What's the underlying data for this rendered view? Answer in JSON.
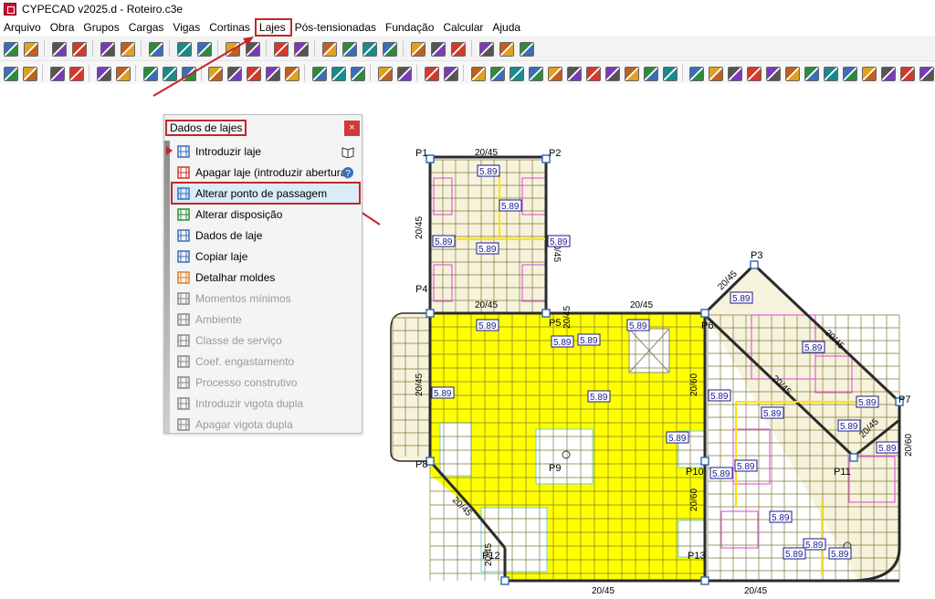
{
  "window": {
    "title": "CYPECAD v2025.d - Roteiro.c3e"
  },
  "menu": {
    "items": [
      "Arquivo",
      "Obra",
      "Grupos",
      "Cargas",
      "Vigas",
      "Cortinas",
      "Lajes",
      "Pós-tensionadas",
      "Fundação",
      "Calcular",
      "Ajuda"
    ],
    "highlighted": "Lajes"
  },
  "panel": {
    "title": "Dados de lajes",
    "close_label": "×",
    "items": [
      {
        "label": "Introduzir laje",
        "enabled": true,
        "icon": "introduzir-laje-icon"
      },
      {
        "label": "Apagar laje (introduzir abertura)",
        "enabled": true,
        "icon": "apagar-laje-icon"
      },
      {
        "label": "Alterar ponto de passagem",
        "enabled": true,
        "icon": "alterar-ponto-icon",
        "selected": true
      },
      {
        "label": "Alterar disposição",
        "enabled": true,
        "icon": "alterar-disposicao-icon"
      },
      {
        "label": "Dados de laje",
        "enabled": true,
        "icon": "dados-laje-icon"
      },
      {
        "label": "Copiar laje",
        "enabled": true,
        "icon": "copiar-laje-icon"
      },
      {
        "label": "Detalhar moldes",
        "enabled": true,
        "icon": "detalhar-moldes-icon"
      },
      {
        "label": "Momentos mínimos",
        "enabled": false,
        "icon": "momentos-icon"
      },
      {
        "label": "Ambiente",
        "enabled": false,
        "icon": "ambiente-icon"
      },
      {
        "label": "Classe de serviço",
        "enabled": false,
        "icon": "classe-icon"
      },
      {
        "label": "Coef. engastamento",
        "enabled": false,
        "icon": "coef-icon"
      },
      {
        "label": "Processo construtivo",
        "enabled": false,
        "icon": "processo-icon"
      },
      {
        "label": "Introduzir vigota dupla",
        "enabled": false,
        "icon": "introduzir-vigota-icon"
      },
      {
        "label": "Apagar vigota dupla",
        "enabled": false,
        "icon": "apagar-vigota-icon"
      }
    ]
  },
  "drawing": {
    "pillars": [
      "P1",
      "P2",
      "P3",
      "P4",
      "P5",
      "P6",
      "P7",
      "P8",
      "P9",
      "P10",
      "P11",
      "P12",
      "P13"
    ],
    "beam_labels": [
      "20/45",
      "20/60"
    ],
    "slab_value": "5.89"
  },
  "colors": {
    "slab_fill": "#ffff00",
    "grid_line": "#7a7a3a",
    "beam": "#2b2b2b",
    "magenta": "#e040e0",
    "accent_red": "#c0282b",
    "label_blue": "#1a1a8c"
  }
}
